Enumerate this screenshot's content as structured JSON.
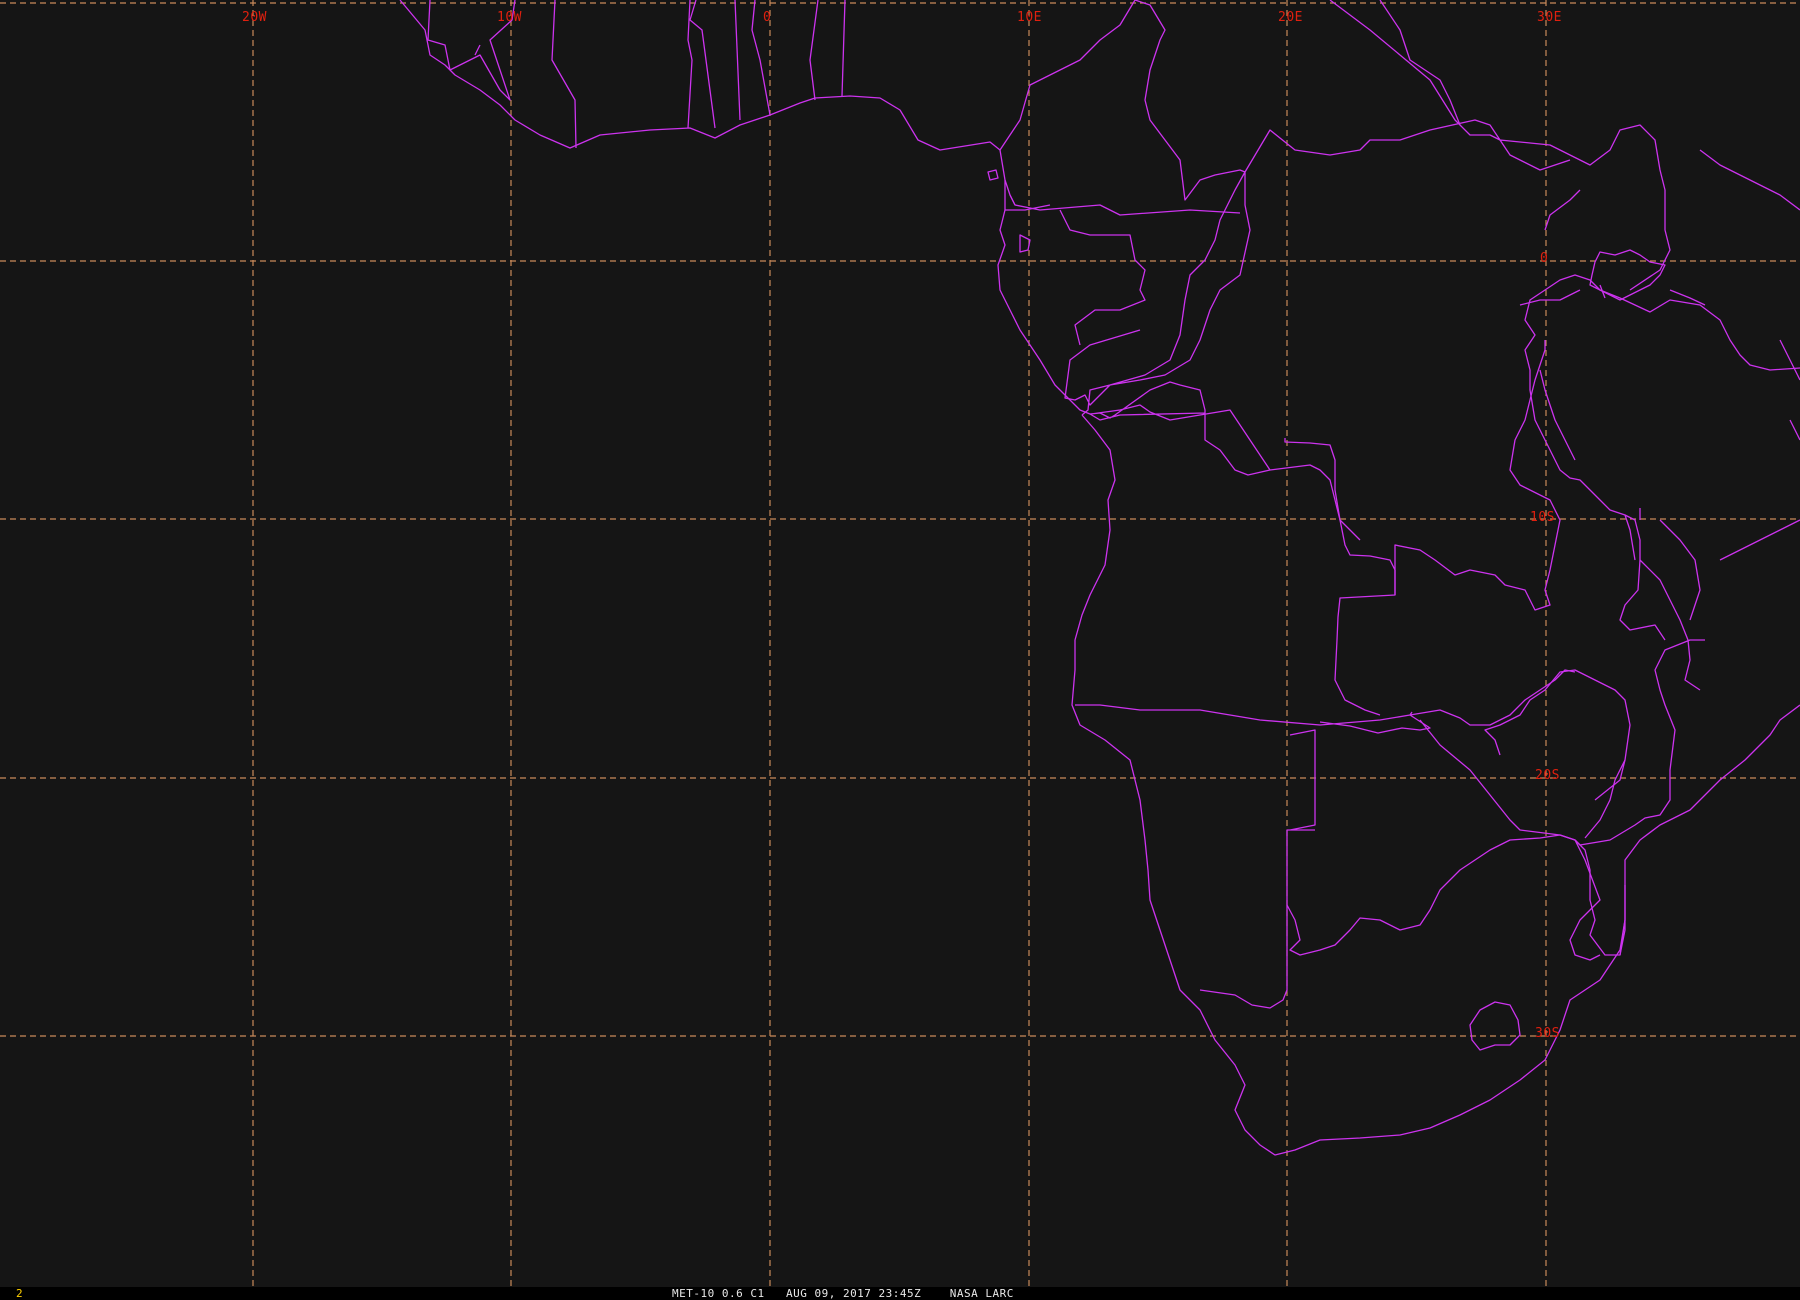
{
  "map": {
    "longitude_labels": [
      "20W",
      "10W",
      "0",
      "10E",
      "20E",
      "30E"
    ],
    "latitude_labels": [
      "0",
      "10S",
      "20S",
      "30S"
    ],
    "colors": {
      "background": "#151515",
      "boundaries": "#cc33ee",
      "graticule": "#c98a5a",
      "labels": "#e0200f"
    }
  },
  "status_bar": {
    "frame_number": "2",
    "caption": "MET-10 0.6 C1   AUG 09, 2017 23:45Z    NASA LARC"
  }
}
